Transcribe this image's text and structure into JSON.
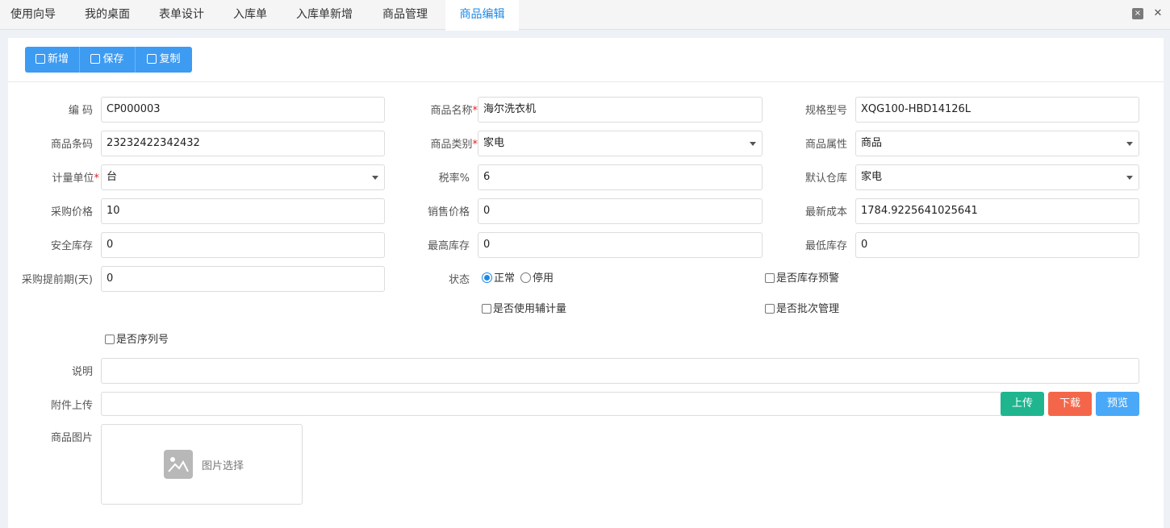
{
  "tabs": [
    "使用向导",
    "我的桌面",
    "表单设计",
    "入库单",
    "入库单新增",
    "商品管理",
    "商品编辑"
  ],
  "active_tab": "商品编辑",
  "window_controls": {
    "close_tab_icon": "×",
    "close_window_icon": "✕"
  },
  "toolbar": {
    "add": "新增",
    "save": "保存",
    "copy": "复制"
  },
  "required_mark": "*",
  "fields": {
    "code": {
      "label": "编 码",
      "value": "CP000003"
    },
    "name": {
      "label": "商品名称",
      "value": "海尔洗衣机"
    },
    "spec": {
      "label": "规格型号",
      "value": "XQG100-HBD14126L"
    },
    "barcode": {
      "label": "商品条码",
      "value": "23232422342432"
    },
    "category": {
      "label": "商品类别",
      "value": "家电"
    },
    "attribute": {
      "label": "商品属性",
      "value": "商品"
    },
    "unit": {
      "label": "计量单位",
      "value": "台"
    },
    "tax_rate": {
      "label": "税率%",
      "value": "6"
    },
    "warehouse": {
      "label": "默认仓库",
      "value": "家电"
    },
    "purchase_price": {
      "label": "采购价格",
      "value": "10"
    },
    "sale_price": {
      "label": "销售价格",
      "value": "0"
    },
    "latest_cost": {
      "label": "最新成本",
      "value": "1784.9225641025641"
    },
    "safety_stock": {
      "label": "安全库存",
      "value": "0"
    },
    "max_stock": {
      "label": "最高库存",
      "value": "0"
    },
    "min_stock": {
      "label": "最低库存",
      "value": "0"
    },
    "lead_time": {
      "label": "采购提前期(天)",
      "value": "0"
    },
    "description": {
      "label": "说明",
      "value": ""
    },
    "attachment": {
      "label": "附件上传",
      "value": ""
    },
    "image": {
      "label": "商品图片",
      "placeholder": "图片选择"
    }
  },
  "status": {
    "label": "状态",
    "options": [
      "正常",
      "停用"
    ],
    "selected": "正常"
  },
  "checkboxes": {
    "stock_warning": {
      "label": "是否库存预警",
      "checked": false
    },
    "aux_unit": {
      "label": "是否使用辅计量",
      "checked": false
    },
    "batch": {
      "label": "是否批次管理",
      "checked": false
    },
    "serial": {
      "label": "是否序列号",
      "checked": false
    }
  },
  "attachment_buttons": {
    "upload": "上传",
    "download": "下载",
    "preview": "预览"
  },
  "colors": {
    "primary": "#3d9bf2",
    "active_tab": "#1e88e5",
    "upload": "#1fb58f",
    "download": "#f4664a",
    "preview": "#4aa8f8",
    "required": "#e02020"
  }
}
